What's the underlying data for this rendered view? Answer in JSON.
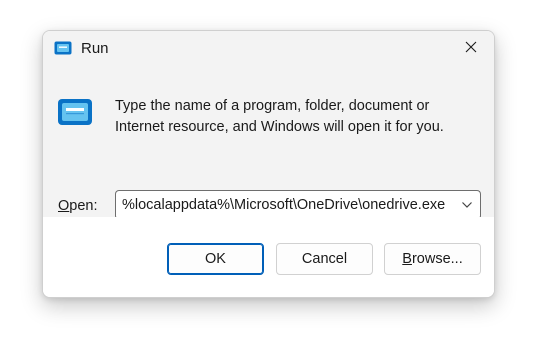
{
  "window": {
    "title": "Run",
    "icon": "run-icon",
    "close_icon": "close-icon"
  },
  "content": {
    "icon": "run-icon",
    "description_line1": "Type the name of a program, folder, document or",
    "description_line2": "Internet resource, and Windows will open it for you."
  },
  "open_field": {
    "label_underlined": "O",
    "label_rest": "pen:",
    "value": "%localappdata%\\Microsoft\\OneDrive\\onedrive.exe",
    "dropdown_icon": "chevron-down-icon"
  },
  "buttons": {
    "ok": "OK",
    "cancel": "Cancel",
    "browse_underlined": "B",
    "browse_rest": "rowse..."
  },
  "colors": {
    "accent": "#005fb8",
    "icon_blue": "#0a72c6",
    "icon_light": "#65c3f0"
  }
}
